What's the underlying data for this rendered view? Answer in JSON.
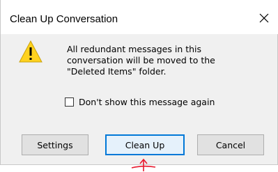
{
  "dialog": {
    "title": "Clean Up Conversation",
    "close_icon": "close-icon",
    "warning_icon": "warning-icon",
    "message": "All redundant messages in this\nconversation will be moved to the\n\"Deleted Items\" folder.",
    "checkbox": {
      "label": "Don't show this message again",
      "checked": false
    },
    "buttons": {
      "settings": "Settings",
      "clean_up": "Clean Up",
      "cancel": "Cancel"
    }
  },
  "colors": {
    "dialog_background": "#f0f0f0",
    "titlebar_background": "#ffffff",
    "default_button_border": "#0078d7",
    "warning_yellow": "#ffd21f",
    "annotation_red": "#e8182d"
  }
}
